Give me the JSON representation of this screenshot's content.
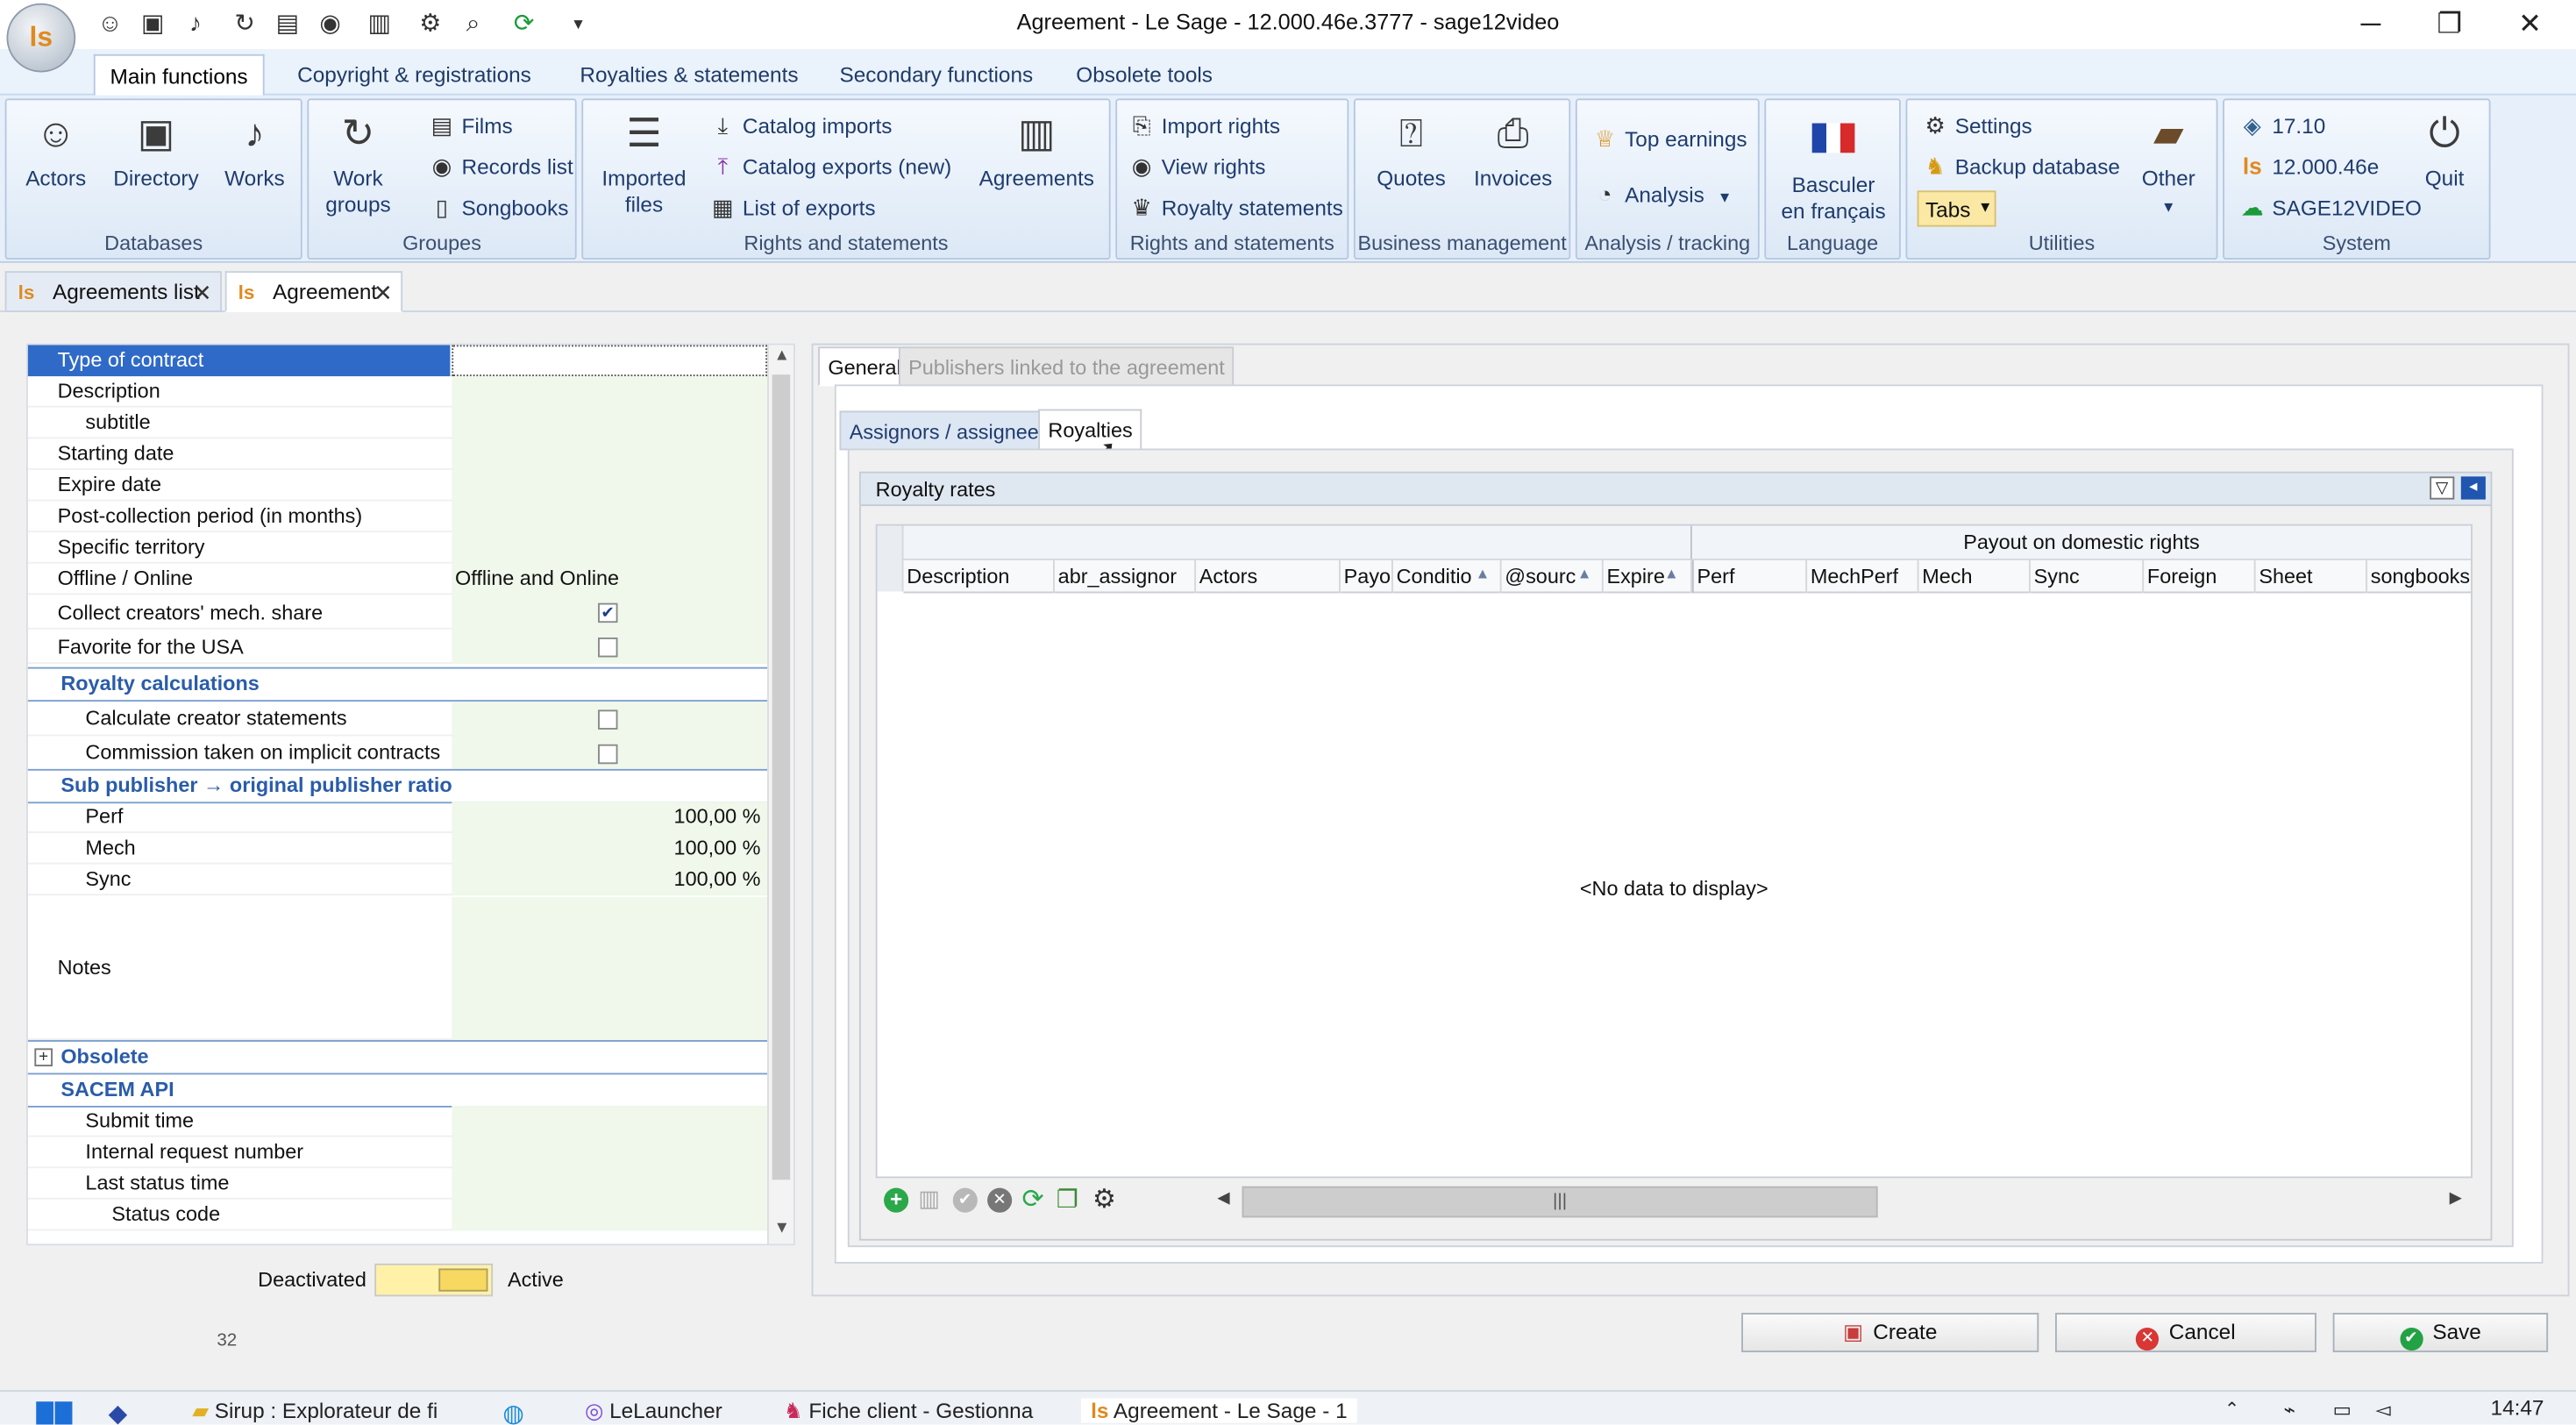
{
  "window": {
    "title": "Agreement - Le Sage - 12.000.46e.3777 - sage12video",
    "minimize": "─",
    "restore": "❐",
    "close": "✕"
  },
  "ribbon_tabs": [
    "Main functions",
    "Copyright & registrations",
    "Royalties & statements",
    "Secondary functions",
    "Obsolete tools"
  ],
  "ribbon": {
    "databases": {
      "actors": "Actors",
      "directory": "Directory",
      "works": "Works",
      "label": "Databases"
    },
    "groupes": {
      "work_groups_1": "Work",
      "work_groups_2": "groups",
      "films": "Films",
      "records_list": "Records list",
      "songbooks": "Songbooks",
      "label": "Groupes"
    },
    "rights1": {
      "imported_1": "Imported",
      "imported_2": "files",
      "catalog_imports": "Catalog imports",
      "catalog_exports": "Catalog exports (new)",
      "list_exports": "List of exports",
      "agreements": "Agreements",
      "label": "Rights and statements"
    },
    "rights2": {
      "import_rights": "Import rights",
      "view_rights": "View rights",
      "royalty_statements": "Royalty statements",
      "label": "Rights and statements"
    },
    "business": {
      "quotes": "Quotes",
      "invoices": "Invoices",
      "label": "Business management"
    },
    "analysis": {
      "top_earnings": "Top earnings",
      "analysis": "Analysis",
      "label": "Analysis / tracking"
    },
    "language": {
      "line1": "Basculer",
      "line2": "en français",
      "label": "Language"
    },
    "utilities": {
      "settings": "Settings",
      "backup": "Backup database",
      "tabs": "Tabs",
      "other": "Other",
      "label": "Utilities"
    },
    "system": {
      "v1": "17.10",
      "v2": "12.000.46e",
      "v3": "SAGE12VIDEO",
      "quit": "Quit",
      "label": "System"
    }
  },
  "doc_tabs": [
    "Agreements list",
    "Agreement"
  ],
  "props": {
    "type_of_contract": "Type of contract",
    "description": "Description",
    "subtitle": "subtitle",
    "starting_date": "Starting date",
    "expire_date": "Expire date",
    "post_collection": "Post-collection period (in months)",
    "specific_territory": "Specific territory",
    "offline_online": "Offline / Online",
    "offline_online_value": "Offline and Online",
    "collect_creators": "Collect creators' mech. share",
    "favorite_usa": "Favorite for the USA",
    "royalty_calculations": "Royalty calculations",
    "calc_creator": "Calculate creator statements",
    "commission": "Commission taken on implicit contracts",
    "sub_publisher": "Sub publisher → original publisher ratio",
    "perf": "Perf",
    "perf_value": "100,00 %",
    "mech": "Mech",
    "mech_value": "100,00 %",
    "sync": "Sync",
    "sync_value": "100,00 %",
    "notes": "Notes",
    "obsolete": "Obsolete",
    "sacem_api": "SACEM API",
    "submit_time": "Submit time",
    "internal_request": "Internal request number",
    "last_status_time": "Last status time",
    "status_code": "Status code"
  },
  "toggle": {
    "deactivated": "Deactivated",
    "active": "Active"
  },
  "count": "32",
  "panel_tabs": [
    "General",
    "Publishers linked to the agreement"
  ],
  "sub_tabs": [
    "Assignors / assignees",
    "Royalties"
  ],
  "grid": {
    "title": "Royalty rates",
    "band": "Payout on domestic rights",
    "columns": [
      "Description",
      "abr_assignor",
      "Actors",
      "Payou",
      "Conditio",
      "@sourc",
      "Expire",
      "Perf",
      "MechPerf",
      "Mech",
      "Sync",
      "Foreign",
      "Sheet",
      "songbooks"
    ],
    "empty": "<No data to display>"
  },
  "buttons": {
    "create": "Create",
    "cancel": "Cancel",
    "save": "Save"
  },
  "taskbar": {
    "t1": "Sirup : Explorateur de fi",
    "t2": "LeLauncher",
    "t3": "Fiche client - Gestionna",
    "t4": "Agreement - Le Sage - 1",
    "time": "14:47"
  }
}
